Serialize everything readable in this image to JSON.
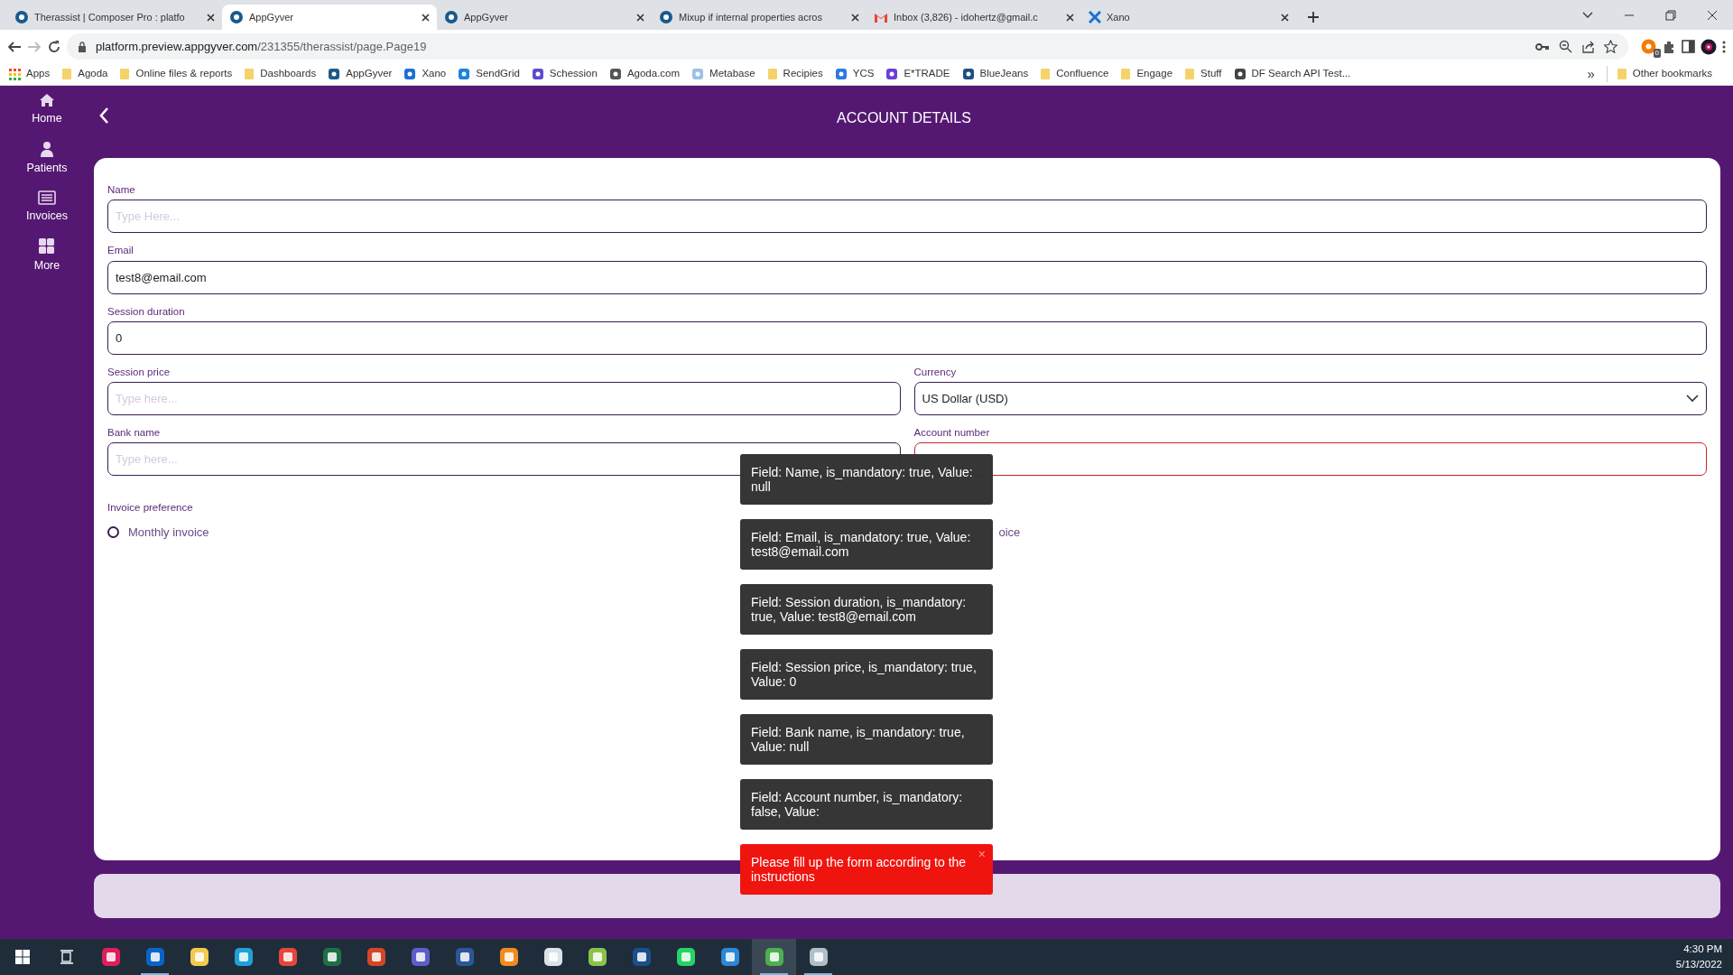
{
  "browser": {
    "tabs": [
      {
        "title": "Therassist | Composer Pro : platfo",
        "kind": "appgyver",
        "selected": false
      },
      {
        "title": "AppGyver",
        "kind": "appgyver",
        "selected": true
      },
      {
        "title": "AppGyver",
        "kind": "appgyver",
        "selected": false
      },
      {
        "title": "Mixup if internal properties acros",
        "kind": "appgyver",
        "selected": false
      },
      {
        "title": "Inbox (3,826) - idohertz@gmail.c",
        "kind": "gmail",
        "selected": false
      },
      {
        "title": "Xano",
        "kind": "xano",
        "selected": false
      }
    ],
    "url_host": "platform.preview.appgyver.com",
    "url_path": "/231355/therassist/page.Page19",
    "extension_badge": "0",
    "bookmarks": [
      {
        "label": "Apps",
        "kind": "apps"
      },
      {
        "label": "Agoda",
        "kind": "folder"
      },
      {
        "label": "Online files & reports",
        "kind": "folder"
      },
      {
        "label": "Dashboards",
        "kind": "folder"
      },
      {
        "label": "AppGyver",
        "kind": "site",
        "color": "#1a5a8c"
      },
      {
        "label": "Xano",
        "kind": "site",
        "color": "#1d6fd6"
      },
      {
        "label": "SendGrid",
        "kind": "site",
        "color": "#1a82e2"
      },
      {
        "label": "Schession",
        "kind": "site",
        "color": "#5b4ccf"
      },
      {
        "label": "Agoda.com",
        "kind": "site",
        "color": "#555555"
      },
      {
        "label": "Metabase",
        "kind": "site",
        "color": "#9cc0e6"
      },
      {
        "label": "Recipies",
        "kind": "folder"
      },
      {
        "label": "YCS",
        "kind": "site",
        "color": "#2a7ae2"
      },
      {
        "label": "E*TRADE",
        "kind": "site",
        "color": "#6b3fd4"
      },
      {
        "label": "BlueJeans",
        "kind": "site",
        "color": "#1b4f8a"
      },
      {
        "label": "Confluence",
        "kind": "folder"
      },
      {
        "label": "Engage",
        "kind": "folder"
      },
      {
        "label": "Stuff",
        "kind": "folder"
      },
      {
        "label": "DF Search API Test...",
        "kind": "site",
        "color": "#444444"
      }
    ],
    "more_bookmarks": "»",
    "other_bookmarks": "Other bookmarks"
  },
  "sidebar": {
    "items": [
      {
        "label": "Home",
        "kind": "home"
      },
      {
        "label": "Patients",
        "kind": "person"
      },
      {
        "label": "Invoices",
        "kind": "list"
      },
      {
        "label": "More",
        "kind": "grid"
      }
    ]
  },
  "header": {
    "title": "ACCOUNT DETAILS"
  },
  "form": {
    "rows": [
      [
        {
          "label": "Name",
          "kind": "text",
          "placeholder": "Type Here..."
        }
      ],
      [
        {
          "label": "Email",
          "kind": "text",
          "value": "test8@email.com"
        }
      ],
      [
        {
          "label": "Session duration",
          "kind": "text",
          "value": "0"
        }
      ],
      [
        {
          "label": "Session price",
          "kind": "text",
          "placeholder": "Type here..."
        },
        {
          "label": "Currency",
          "kind": "select",
          "value": "US Dollar (USD)"
        }
      ],
      [
        {
          "label": "Bank name",
          "kind": "text",
          "placeholder": "Type here..."
        },
        {
          "label": "Account number",
          "kind": "text",
          "invalid": true
        }
      ]
    ],
    "invoice_preference": {
      "label": "Invoice preference",
      "options": [
        {
          "label": "Monthly invoice",
          "checked": false
        },
        {
          "label": "oice"
        }
      ]
    }
  },
  "toasts": [
    {
      "kind": "info",
      "text": "Field: Name, is_mandatory: true, Value: null"
    },
    {
      "kind": "info",
      "text": "Field: Email, is_mandatory: true, Value: test8@email.com"
    },
    {
      "kind": "info",
      "text": "Field: Session duration, is_mandatory: true, Value: test8@email.com"
    },
    {
      "kind": "info",
      "text": "Field: Session price, is_mandatory: true, Value: 0"
    },
    {
      "kind": "info",
      "text": "Field: Bank name, is_mandatory: true, Value: null"
    },
    {
      "kind": "info",
      "text": "Field: Account number, is_mandatory: false, Value:"
    },
    {
      "kind": "error",
      "text": "Please fill up the form according to the instructions",
      "close": "×"
    }
  ],
  "taskbar": {
    "apps": [
      {
        "color": "#e01e5a",
        "running": false,
        "selected": false
      },
      {
        "color": "#0a64c8",
        "running": true,
        "selected": false
      },
      {
        "color": "#f2c94c",
        "running": false,
        "selected": false
      },
      {
        "color": "#1fa0d8",
        "running": false,
        "selected": false
      },
      {
        "color": "#e8453c",
        "running": false,
        "selected": false
      },
      {
        "color": "#1d7044",
        "running": false,
        "selected": false
      },
      {
        "color": "#d24726",
        "running": false,
        "selected": false
      },
      {
        "color": "#5b5fc7",
        "running": false,
        "selected": false
      },
      {
        "color": "#2b579a",
        "running": false,
        "selected": false
      },
      {
        "color": "#f08c1f",
        "running": false,
        "selected": false
      },
      {
        "color": "#d9e3e8",
        "running": false,
        "selected": false
      },
      {
        "color": "#8bc34a",
        "running": false,
        "selected": false
      },
      {
        "color": "#1a4f8c",
        "running": false,
        "selected": false
      },
      {
        "color": "#25d366",
        "running": false,
        "selected": false
      },
      {
        "color": "#2b88d8",
        "running": false,
        "selected": false
      },
      {
        "color": "#4caf50",
        "running": true,
        "selected": true
      },
      {
        "color": "#b0bec5",
        "running": true,
        "selected": false
      }
    ],
    "time": "4:30 PM",
    "date": "5/13/2022"
  }
}
